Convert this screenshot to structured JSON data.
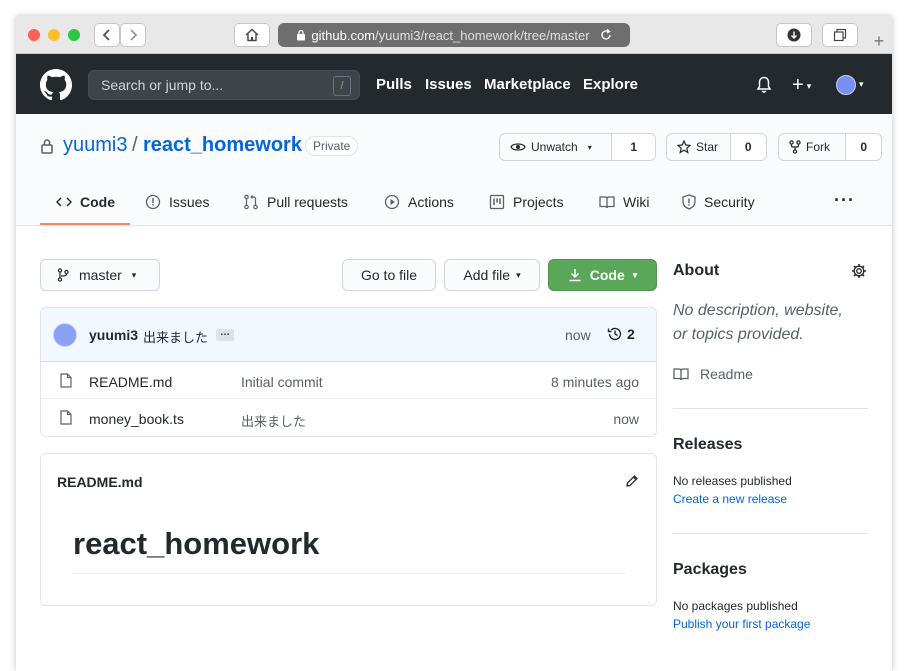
{
  "browser": {
    "url_host": "github.com",
    "url_path": "/yuumi3/react_homework/tree/master"
  },
  "header": {
    "search_placeholder": "Search or jump to...",
    "search_key": "/",
    "nav": [
      "Pulls",
      "Issues",
      "Marketplace",
      "Explore"
    ]
  },
  "repo": {
    "owner": "yuumi3",
    "separator": "/",
    "name": "react_homework",
    "visibility": "Private",
    "watch_label": "Unwatch",
    "watch_count": "1",
    "star_label": "Star",
    "star_count": "0",
    "fork_label": "Fork",
    "fork_count": "0"
  },
  "tabs": [
    "Code",
    "Issues",
    "Pull requests",
    "Actions",
    "Projects",
    "Wiki",
    "Security"
  ],
  "more_label": "···",
  "branch": "master",
  "actions": {
    "go_to_file": "Go to file",
    "add_file": "Add file",
    "code": "Code"
  },
  "commit": {
    "author": "yuumi3",
    "message": "出来ました",
    "ellipsis": "…",
    "time": "now",
    "count": "2"
  },
  "files": [
    {
      "name": "README.md",
      "message": "Initial commit",
      "time": "8 minutes ago"
    },
    {
      "name": "money_book.ts",
      "message": "出来ました",
      "time": "now"
    }
  ],
  "readme": {
    "filename": "README.md",
    "heading": "react_homework"
  },
  "about": {
    "title": "About",
    "description_line1": "No description, website,",
    "description_line2": "or topics provided.",
    "readme_link": "Readme"
  },
  "releases": {
    "title": "Releases",
    "empty": "No releases published",
    "create_link": "Create a new release"
  },
  "packages": {
    "title": "Packages",
    "empty": "No packages published",
    "publish_link": "Publish your first package"
  },
  "colors": {
    "header_bg": "#24292e",
    "accent_link": "#0366d6",
    "code_button": "#2ea44f",
    "active_tab_underline": "#f9826c"
  }
}
